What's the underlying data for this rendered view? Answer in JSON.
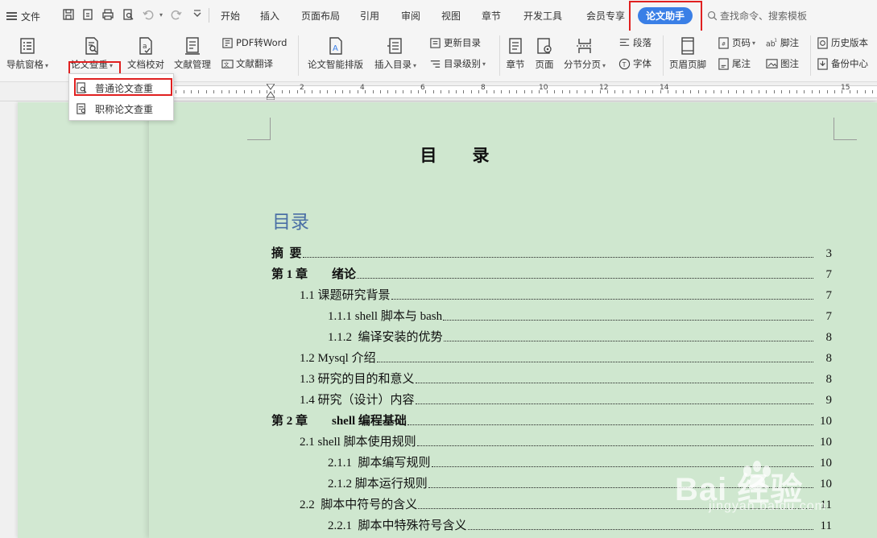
{
  "menubar": {
    "file_label": "文件",
    "tabs": [
      "开始",
      "插入",
      "页面布局",
      "引用",
      "审阅",
      "视图",
      "章节",
      "开发工具",
      "会员专享"
    ],
    "active_tab": "论文助手",
    "search_placeholder": "查找命令、搜索模板"
  },
  "ribbon": {
    "nav_pane": "导航窗格",
    "paper_check": "论文查重",
    "doc_proof": "文档校对",
    "ref_manage": "文献管理",
    "pdf_to_word": "PDF转Word",
    "ref_translate": "文献翻译",
    "smart_layout": "论文智能排版",
    "insert_toc": "插入目录",
    "update_toc": "更新目录",
    "toc_level": "目录级别",
    "chapter": "章节",
    "page": "页面",
    "section_break": "分节分页",
    "paragraph": "段落",
    "font": "字体",
    "header_footer": "页眉页脚",
    "page_num": "页码",
    "footnote": "脚注",
    "endnote": "尾注",
    "caption": "图注",
    "history": "历史版本",
    "backup": "备份中心"
  },
  "dropdown": {
    "items": [
      "普通论文查重",
      "职称论文查重"
    ]
  },
  "ruler": {
    "numbers": [
      "2",
      "4",
      "6",
      "8",
      "10",
      "12",
      "14",
      "15"
    ]
  },
  "document": {
    "heading": "目录",
    "toc_title": "目录",
    "entries": [
      {
        "text": "摘  要",
        "page": "3"
      },
      {
        "text": "第 1 章        绪论",
        "page": "7"
      },
      {
        "text": "1.1 课题研究背景",
        "page": "7"
      },
      {
        "text": "1.1.1 shell 脚本与 bash",
        "page": "7"
      },
      {
        "text": "1.1.2  编译安装的优势",
        "page": "8"
      },
      {
        "text": "1.2 Mysql 介绍",
        "page": "8"
      },
      {
        "text": "1.3 研究的目的和意义",
        "page": "8"
      },
      {
        "text": "1.4 研究（设计）内容",
        "page": "9"
      },
      {
        "text": "第 2 章        shell 编程基础",
        "page": "10"
      },
      {
        "text": "2.1 shell 脚本使用规则",
        "page": "10"
      },
      {
        "text": "2.1.1  脚本编写规则",
        "page": "10"
      },
      {
        "text": "2.1.2 脚本运行规则",
        "page": "10"
      },
      {
        "text": "2.2  脚本中符号的含义",
        "page": "11"
      },
      {
        "text": "2.2.1  脚本中特殊符号含义",
        "page": "11"
      }
    ]
  },
  "watermark": {
    "brand": "Bai  经验",
    "url": "jingyan.baidu.com"
  }
}
